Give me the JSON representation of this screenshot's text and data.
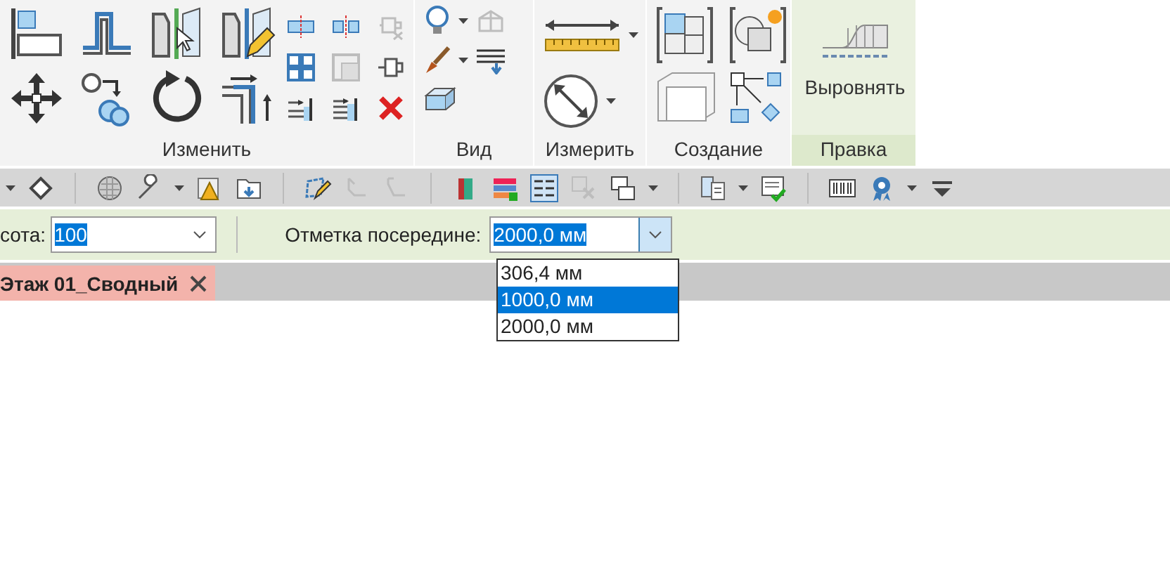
{
  "ribbon": {
    "panels": [
      {
        "label": "Изменить",
        "contextual": false
      },
      {
        "label": "Вид",
        "contextual": false
      },
      {
        "label": "Измерить",
        "contextual": false
      },
      {
        "label": "Создание",
        "contextual": false
      },
      {
        "label": "Правка",
        "contextual": true,
        "button": "Выровнять"
      }
    ]
  },
  "options_bar": {
    "height_label": "сота:",
    "height_value": "100",
    "elevation_label": "Отметка посередине:",
    "elevation_value": "2000,0 мм",
    "elevation_dropdown": {
      "expanded": true,
      "options": [
        {
          "label": "306,4 мм",
          "selected": false
        },
        {
          "label": "1000,0 мм",
          "selected": true
        },
        {
          "label": "2000,0 мм",
          "selected": false
        }
      ]
    }
  },
  "view_tabs": [
    {
      "label": "Этаж 01_Сводный",
      "selected": true
    }
  ]
}
